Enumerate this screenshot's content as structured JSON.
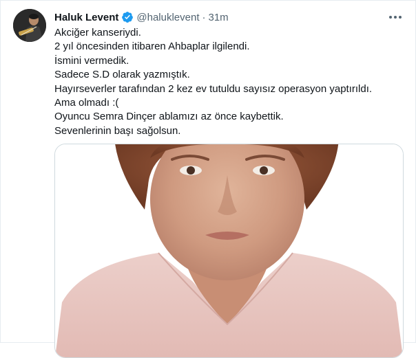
{
  "tweet": {
    "author": {
      "display_name": "Haluk Levent",
      "handle": "@haluklevent",
      "verified": true,
      "verified_icon": "verified-badge-icon",
      "avatar_icon": "avatar-photo"
    },
    "separator": "·",
    "time": "31m",
    "more_icon": "more-options-icon",
    "lines": [
      "Akciğer kanseriydi.",
      "2 yıl öncesinden itibaren Ahbaplar ilgilendi.",
      "İsmini vermedik.",
      "Sadece S.D olarak yazmıştık.",
      "Hayırseverler tarafından 2 kez ev tutuldu sayısız operasyon yaptırıldı.",
      "Ama olmadı :(",
      "Oyuncu Semra Dinçer ablamızı az önce kaybettik.",
      "Sevenlerinin başı sağolsun."
    ],
    "media": {
      "type": "photo",
      "icon": "portrait-photo"
    }
  },
  "colors": {
    "text": "#0f1419",
    "secondary": "#536471",
    "verified": "#1d9bf0",
    "border": "#cfd9de"
  }
}
